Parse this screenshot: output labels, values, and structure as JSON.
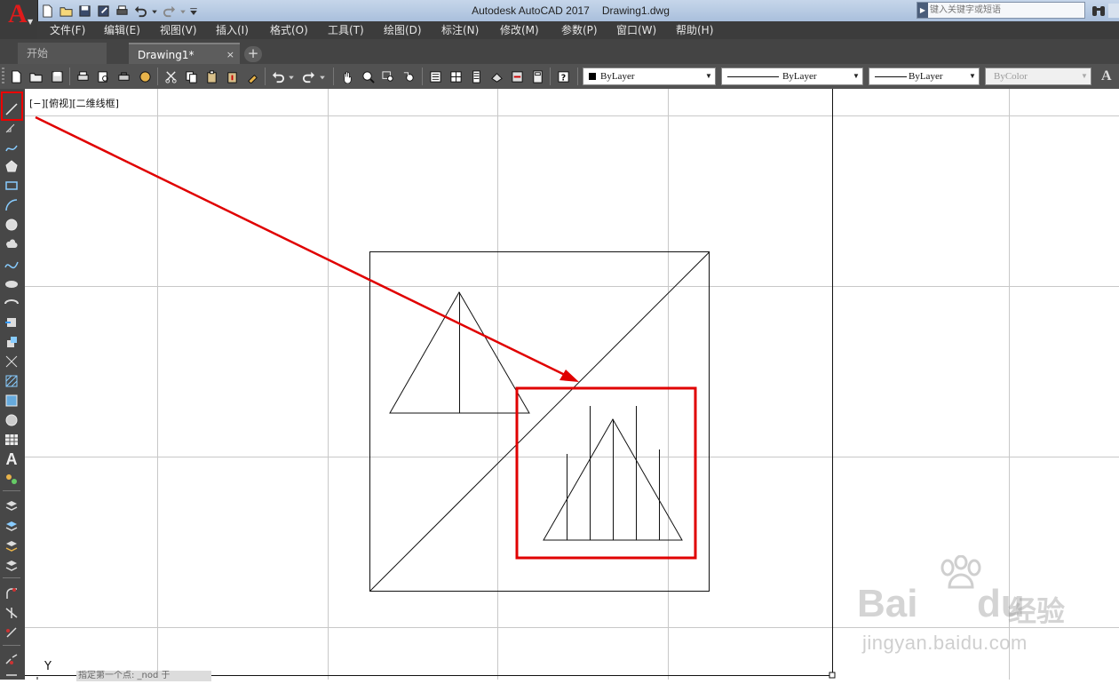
{
  "app": {
    "logo_letter": "A",
    "title": "Autodesk AutoCAD 2017",
    "document": "Drawing1.dwg"
  },
  "search": {
    "placeholder": "键入关键字或短语"
  },
  "menu": [
    {
      "label": "文件(F)"
    },
    {
      "label": "编辑(E)"
    },
    {
      "label": "视图(V)"
    },
    {
      "label": "插入(I)"
    },
    {
      "label": "格式(O)"
    },
    {
      "label": "工具(T)"
    },
    {
      "label": "绘图(D)"
    },
    {
      "label": "标注(N)"
    },
    {
      "label": "修改(M)"
    },
    {
      "label": "参数(P)"
    },
    {
      "label": "窗口(W)"
    },
    {
      "label": "帮助(H)"
    }
  ],
  "tabs": {
    "start": "开始",
    "drawing": "Drawing1*",
    "close_glyph": "×",
    "new_glyph": "+"
  },
  "properties": {
    "color": "ByLayer",
    "linetype": "ByLayer",
    "lineweight": "ByLayer",
    "plotstyle": "ByColor"
  },
  "text_tool_label": "A",
  "viewport_label": "[−][俯视][二维线框]",
  "ucs_axis": "Y",
  "command_prompt": "指定第一个点: _nod 于",
  "watermark": {
    "bai": "Bai",
    "du": "du",
    "jingyan": "经验",
    "url": "jingyan.baidu.com"
  },
  "colors": {
    "highlight": "#e00000",
    "canvas_bg": "#ffffff",
    "grid": "#c8c8c8",
    "drawing": "#111111"
  }
}
